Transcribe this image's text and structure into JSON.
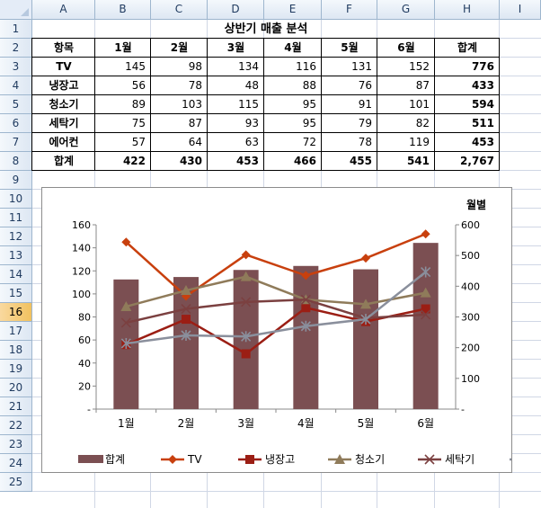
{
  "columns": [
    "A",
    "B",
    "C",
    "D",
    "E",
    "F",
    "G",
    "H",
    "I"
  ],
  "rows": [
    "1",
    "2",
    "3",
    "4",
    "5",
    "6",
    "7",
    "8",
    "9",
    "10",
    "11",
    "12",
    "13",
    "14",
    "15",
    "16",
    "17",
    "18",
    "19",
    "20",
    "21",
    "22",
    "23",
    "24",
    "25"
  ],
  "selected_row": "16",
  "table": {
    "title": "상반기 매출 분석",
    "header": [
      "항목",
      "1월",
      "2월",
      "3월",
      "4월",
      "5월",
      "6월",
      "합계"
    ],
    "body": [
      [
        "TV",
        "145",
        "98",
        "134",
        "116",
        "131",
        "152",
        "776"
      ],
      [
        "냉장고",
        "56",
        "78",
        "48",
        "88",
        "76",
        "87",
        "433"
      ],
      [
        "청소기",
        "89",
        "103",
        "115",
        "95",
        "91",
        "101",
        "594"
      ],
      [
        "세탁기",
        "75",
        "87",
        "93",
        "95",
        "79",
        "82",
        "511"
      ],
      [
        "에어컨",
        "57",
        "64",
        "63",
        "72",
        "78",
        "119",
        "453"
      ],
      [
        "합계",
        "422",
        "430",
        "453",
        "466",
        "455",
        "541",
        "2,767"
      ]
    ]
  },
  "chart_data": {
    "type": "bar",
    "categories": [
      "1월",
      "2월",
      "3월",
      "4월",
      "5월",
      "6월"
    ],
    "secondary_axis_title": "월별",
    "ylim": [
      0,
      160
    ],
    "y_ticks": [
      "160",
      "140",
      "120",
      "100",
      "80",
      "60",
      "40",
      "20",
      "-"
    ],
    "y2lim": [
      0,
      600
    ],
    "y2_ticks": [
      "600",
      "500",
      "400",
      "300",
      "200",
      "100",
      "-"
    ],
    "legend_position": "bottom",
    "series": [
      {
        "name": "합계",
        "type": "bar",
        "axis": "secondary",
        "color": "#7b4f52",
        "values": [
          422,
          430,
          453,
          466,
          455,
          541
        ]
      },
      {
        "name": "TV",
        "type": "line",
        "axis": "primary",
        "marker": "diamond",
        "color": "#c8400e",
        "values": [
          145,
          98,
          134,
          116,
          131,
          152
        ]
      },
      {
        "name": "냉장고",
        "type": "line",
        "axis": "primary",
        "marker": "square",
        "color": "#9b1e14",
        "values": [
          56,
          78,
          48,
          88,
          76,
          87
        ]
      },
      {
        "name": "청소기",
        "type": "line",
        "axis": "primary",
        "marker": "triangle",
        "color": "#8f7b5a",
        "values": [
          89,
          103,
          115,
          95,
          91,
          101
        ]
      },
      {
        "name": "세탁기",
        "type": "line",
        "axis": "primary",
        "marker": "x",
        "color": "#7b4040",
        "values": [
          75,
          87,
          93,
          95,
          79,
          82
        ]
      },
      {
        "name": "에어컨",
        "type": "line",
        "axis": "primary",
        "marker": "star",
        "color": "#8a8f9c",
        "values": [
          57,
          64,
          63,
          72,
          78,
          119
        ]
      }
    ]
  }
}
